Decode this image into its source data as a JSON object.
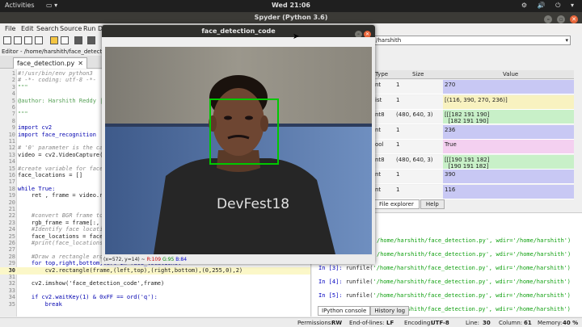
{
  "topbar": {
    "activities": "Activities",
    "app_menu": "▭ ▾",
    "clock": "Wed 21:06",
    "tray": "⚙ 🔊 ⏻ ▾"
  },
  "spyder": {
    "title": "Spyder (Python 3.6)",
    "menu": [
      "File",
      "Edit",
      "Search",
      "Source",
      "Run",
      "D"
    ],
    "editor_path": "Editor - /home/harshith/face_detection",
    "tab_label": "face_detection.py",
    "tab_close": "✕",
    "working_dir": "/harshith",
    "path_dropdown": "▾"
  },
  "code_lines": [
    {
      "n": "1",
      "text": "#!/usr/bin/env python3",
      "cls": "c-comment"
    },
    {
      "n": "2",
      "text": "# -*- coding: utf-8 -*-",
      "cls": "c-comment"
    },
    {
      "n": "3",
      "text": "\"\"\"",
      "cls": "c-doc"
    },
    {
      "n": "4",
      "text": "",
      "cls": "c-plain"
    },
    {
      "n": "5",
      "text": "@author: Harshith Reddy |",
      "cls": "c-doc"
    },
    {
      "n": "6",
      "text": "",
      "cls": "c-plain"
    },
    {
      "n": "7",
      "text": "\"\"\"",
      "cls": "c-doc"
    },
    {
      "n": "8",
      "text": "",
      "cls": "c-plain"
    },
    {
      "n": "9",
      "text": "import cv2",
      "cls": "c-kw"
    },
    {
      "n": "10",
      "text": "import face_recognition",
      "cls": "c-kw"
    },
    {
      "n": "11",
      "text": "",
      "cls": "c-plain"
    },
    {
      "n": "12",
      "text": "# '0' parameter is the cam",
      "cls": "c-comment"
    },
    {
      "n": "13",
      "text": "video = cv2.VideoCapture(0",
      "cls": "c-plain"
    },
    {
      "n": "14",
      "text": "",
      "cls": "c-plain"
    },
    {
      "n": "15",
      "text": "#create variable for face",
      "cls": "c-comment"
    },
    {
      "n": "16",
      "text": "face_locations = []",
      "cls": "c-plain"
    },
    {
      "n": "17",
      "text": "",
      "cls": "c-plain"
    },
    {
      "n": "18",
      "text": "while True:",
      "cls": "c-kw"
    },
    {
      "n": "19",
      "text": "    ret , frame = video.rea",
      "cls": "c-plain"
    },
    {
      "n": "20",
      "text": "",
      "cls": "c-plain"
    },
    {
      "n": "21",
      "text": "",
      "cls": "c-plain"
    },
    {
      "n": "22",
      "text": "    #convert BGR frame to",
      "cls": "c-comment"
    },
    {
      "n": "23",
      "text": "    rgb_frame = frame[:, :",
      "cls": "c-plain"
    },
    {
      "n": "24",
      "text": "    #Identify face locatio",
      "cls": "c-comment"
    },
    {
      "n": "25",
      "text": "    face_locations = face_",
      "cls": "c-plain"
    },
    {
      "n": "26",
      "text": "    #print(face_locations)",
      "cls": "c-comment"
    },
    {
      "n": "27",
      "text": "",
      "cls": "c-plain"
    },
    {
      "n": "28",
      "text": "    #Draw a rectangle arou",
      "cls": "c-comment"
    },
    {
      "n": "29",
      "text": "    for top,right,bottom,left in face_locations:",
      "cls": "c-kw"
    },
    {
      "n": "30",
      "text": "        cv2.rectangle(frame,(left,top),(right,bottom),(0,255,0),2)",
      "cls": "c-plain",
      "current": true
    },
    {
      "n": "31",
      "text": "",
      "cls": "c-plain"
    },
    {
      "n": "32",
      "text": "    cv2.imshow('face_detection_code',frame)",
      "cls": "c-plain"
    },
    {
      "n": "33",
      "text": "",
      "cls": "c-plain"
    },
    {
      "n": "34",
      "text": "    if cv2.waitKey(1) & 0xFF == ord('q'):",
      "cls": "c-kw"
    },
    {
      "n": "35",
      "text": "        break",
      "cls": "c-kw"
    }
  ],
  "variables": {
    "headers": {
      "type": "Type",
      "size": "Size",
      "value": "Value"
    },
    "rows": [
      {
        "type": "nt",
        "size": "1",
        "value": "270",
        "color": "#c8c8f4"
      },
      {
        "type": "ist",
        "size": "1",
        "value": "[(116, 390, 270, 236)]",
        "color": "#f8f2c0"
      },
      {
        "type": "nt8",
        "size": "(480, 640, 3)",
        "value": "[[[182 191 190]\n  [182 191 190]",
        "color": "#c8f0c8"
      },
      {
        "type": "nt",
        "size": "1",
        "value": "236",
        "color": "#c8c8f4"
      },
      {
        "type": "ool",
        "size": "1",
        "value": "True",
        "color": "#f4d0f0"
      },
      {
        "type": "nt8",
        "size": "(480, 640, 3)",
        "value": "[[[190 191 182]\n  [190 191 182]",
        "color": "#c8f0c8"
      },
      {
        "type": "nt",
        "size": "1",
        "value": "390",
        "color": "#c8c8f4"
      },
      {
        "type": "nt",
        "size": "1",
        "value": "116",
        "color": "#c8c8f4"
      }
    ]
  },
  "mid_tabs": [
    "File explorer",
    "Help"
  ],
  "console": {
    "lines": [
      {
        "prompt": "",
        "func": "",
        "arg": "/home/harshith/face_detection.py', wdir='/home/harshith')"
      },
      {
        "prompt": "",
        "func": "",
        "arg": "/home/harshith/face_detection.py', wdir='/home/harshith')"
      },
      {
        "prompt": "In [3]: ",
        "func": "runfile(",
        "arg": "'/home/harshith/face_detection.py', wdir='/home/harshith')"
      },
      {
        "prompt": "In [4]: ",
        "func": "runfile(",
        "arg": "'/home/harshith/face_detection.py', wdir='/home/harshith')"
      },
      {
        "prompt": "In [5]: ",
        "func": "runfile(",
        "arg": "'/home/harshith/face_detection.py', wdir='/home/harshith')"
      },
      {
        "prompt": "In [6]: ",
        "func": "runfile(",
        "arg": "'/home/harshith/face_detection.py', wdir='/home/harshith')"
      }
    ],
    "tabs": [
      "IPython console",
      "History log"
    ]
  },
  "statusbar": {
    "permissions_label": "Permissions:",
    "permissions": "RW",
    "eol_label": "End-of-lines:",
    "eol": "LF",
    "encoding_label": "Encoding:",
    "encoding": "UTF-8",
    "line_label": "Line:",
    "line": "30",
    "column_label": "Column:",
    "column": "61",
    "memory_label": "Memory:",
    "memory": "40 %"
  },
  "cv_window": {
    "title": "face_detection_code",
    "status_xy": "(x=572, y=14) ~",
    "status_r": "R:109",
    "status_g": "G:95",
    "status_b": "B:84",
    "shirt_text": "DevFest18",
    "box_color": "#00c800"
  }
}
